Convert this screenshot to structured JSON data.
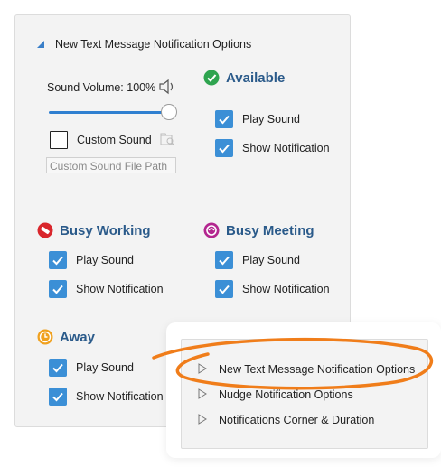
{
  "header": {
    "title": "New Text Message Notification Options"
  },
  "sound": {
    "volume_label": "Sound Volume: 100%",
    "volume_level": 1.0,
    "custom_sound_label": "Custom Sound",
    "custom_sound_checked": false,
    "path_placeholder": "Custom Sound File Path"
  },
  "statuses": {
    "available": {
      "title": "Available",
      "play_sound": "Play Sound",
      "show_notification": "Show Notification"
    },
    "busy_working": {
      "title": "Busy Working",
      "play_sound": "Play Sound",
      "show_notification": "Show Notification"
    },
    "busy_meeting": {
      "title": "Busy Meeting",
      "play_sound": "Play Sound",
      "show_notification": "Show Notification"
    },
    "away": {
      "title": "Away",
      "play_sound": "Play Sound",
      "show_notification": "Show Notification"
    }
  },
  "tree": {
    "items": [
      {
        "label": "New Text Message Notification Options"
      },
      {
        "label": "Nudge Notification Options"
      },
      {
        "label": "Notifications Corner & Duration"
      }
    ]
  },
  "colors": {
    "checkbox": "#3b8fd6",
    "available": "#2ea44f",
    "busy": "#d9262c",
    "meeting": "#b3268f",
    "away": "#f0a11f",
    "highlight": "#f07d1a",
    "title": "#2a5a8a"
  }
}
